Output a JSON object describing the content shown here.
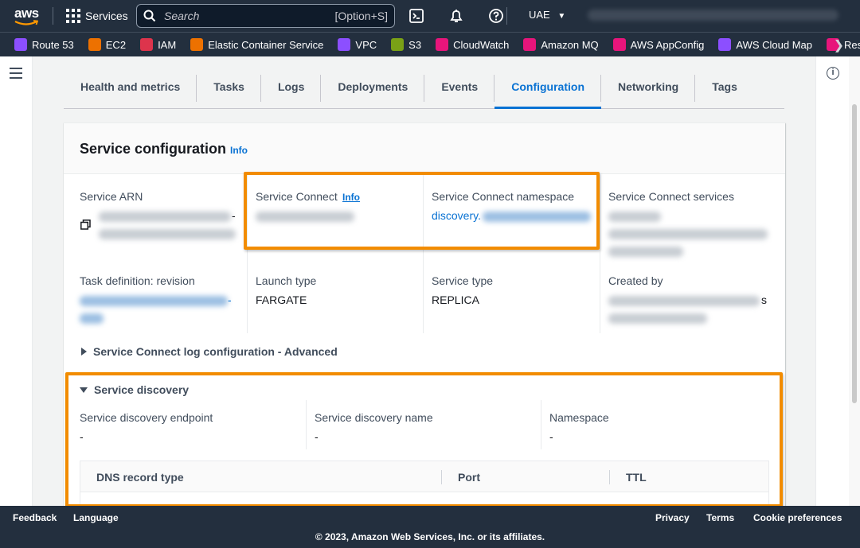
{
  "topnav": {
    "logo": "aws",
    "services_label": "Services",
    "search_placeholder": "Search",
    "search_shortcut": "[Option+S]",
    "region": "UAE"
  },
  "favorites": [
    {
      "label": "Route 53",
      "color": "#8c4fff"
    },
    {
      "label": "EC2",
      "color": "#ed7100"
    },
    {
      "label": "IAM",
      "color": "#dd344c"
    },
    {
      "label": "Elastic Container Service",
      "color": "#ed7100"
    },
    {
      "label": "VPC",
      "color": "#8c4fff"
    },
    {
      "label": "S3",
      "color": "#7aa116"
    },
    {
      "label": "CloudWatch",
      "color": "#e7157b"
    },
    {
      "label": "Amazon MQ",
      "color": "#e7157b"
    },
    {
      "label": "AWS AppConfig",
      "color": "#e7157b"
    },
    {
      "label": "AWS Cloud Map",
      "color": "#8c4fff"
    },
    {
      "label": "Resour",
      "color": "#e7157b"
    }
  ],
  "tabs": [
    {
      "label": "Health and metrics"
    },
    {
      "label": "Tasks"
    },
    {
      "label": "Logs"
    },
    {
      "label": "Deployments"
    },
    {
      "label": "Events"
    },
    {
      "label": "Configuration"
    },
    {
      "label": "Networking"
    },
    {
      "label": "Tags"
    }
  ],
  "active_tab": "Configuration",
  "service_config": {
    "title": "Service configuration",
    "info": "Info",
    "service_arn_label": "Service ARN",
    "service_arn_suffix": "-",
    "service_connect_label": "Service Connect",
    "service_connect_info": "Info",
    "sc_namespace_label": "Service Connect namespace",
    "sc_namespace_value": "discovery.",
    "sc_services_label": "Service Connect services",
    "task_def_label": "Task definition: revision",
    "task_def_suffix": "-",
    "launch_type_label": "Launch type",
    "launch_type_value": "FARGATE",
    "service_type_label": "Service type",
    "service_type_value": "REPLICA",
    "created_by_label": "Created by",
    "created_by_suffix": "s",
    "log_config_expander": "Service Connect log configuration - Advanced"
  },
  "service_discovery": {
    "title": "Service discovery",
    "endpoint_label": "Service discovery endpoint",
    "endpoint_value": "-",
    "name_label": "Service discovery name",
    "name_value": "-",
    "namespace_label": "Namespace",
    "namespace_value": "-",
    "table_headers": [
      "DNS record type",
      "Port",
      "TTL"
    ]
  },
  "footer": {
    "feedback": "Feedback",
    "language": "Language",
    "privacy": "Privacy",
    "terms": "Terms",
    "cookie": "Cookie preferences",
    "copyright": "© 2023, Amazon Web Services, Inc. or its affiliates."
  },
  "colors": {
    "nav_bg": "#232f3e",
    "link": "#0972d3",
    "highlight": "#f28c00"
  }
}
